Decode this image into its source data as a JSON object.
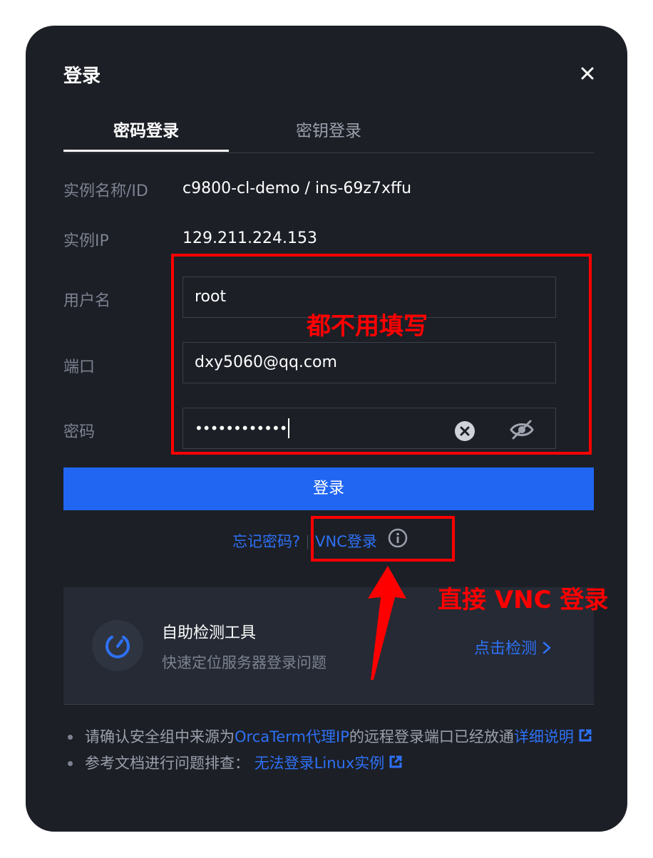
{
  "dialog": {
    "title": "登录"
  },
  "tabs": [
    {
      "label": "密码登录",
      "active": true
    },
    {
      "label": "密钥登录",
      "active": false
    }
  ],
  "instance": {
    "name_label": "实例名称/ID",
    "name_value": "c9800-cl-demo / ins-69z7xffu",
    "ip_label": "实例IP",
    "ip_value": "129.211.224.153"
  },
  "form": {
    "username_label": "用户名",
    "username_value": "root",
    "port_label": "端口",
    "port_value": "dxy5060@qq.com",
    "password_label": "密码",
    "password_value": "••••••••••••"
  },
  "login_button": "登录",
  "links": {
    "forgot_password": "忘记密码?",
    "vnc_login": "VNC登录"
  },
  "tool_card": {
    "title": "自助检测工具",
    "subtitle": "快速定位服务器登录问题",
    "action": "点击检测 "
  },
  "notes": {
    "n1_pre": "请确认安全组中来源为",
    "n1_link": "OrcaTerm代理IP",
    "n1_mid": "的远程登录端口已经放通",
    "n1_link2": "详细说明",
    "n2_pre": "参考文档进行问题排查：",
    "n2_link": "无法登录Linux实例"
  },
  "annotations": {
    "form_note": "都不用填写",
    "vnc_note": "直接 VNC 登录"
  },
  "colors": {
    "background": "#1c1f26",
    "accent": "#2166f3",
    "link": "#2e71f5",
    "annotation": "#ff0000"
  },
  "icons": [
    "close-icon",
    "clear-icon",
    "eye-off-icon",
    "info-icon",
    "tool-gauge-icon",
    "chevron-right-icon",
    "external-link-icon",
    "arrow-annotation"
  ]
}
